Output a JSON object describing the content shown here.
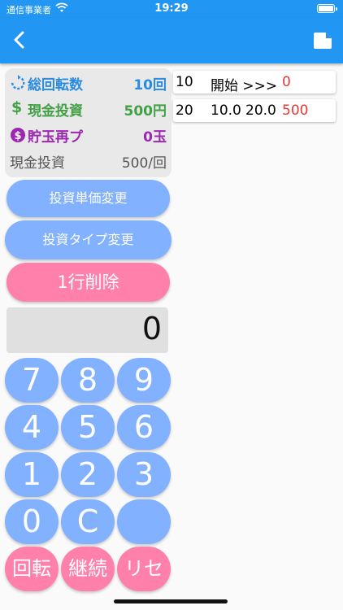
{
  "status_bar": {
    "carrier": "通信事業者",
    "time": "19:29"
  },
  "app_bar": {
    "back_icon": "back-arrow-icon",
    "action_icon": "document-icon"
  },
  "summary": {
    "rotations": {
      "label": "総回転数",
      "value": "10回",
      "icon": "rotate-icon"
    },
    "cash": {
      "label": "現金投資",
      "value": "500円",
      "icon": "dollar-icon"
    },
    "saved": {
      "label": "貯玉再プ",
      "value": "0玉",
      "icon": "coin-icon"
    },
    "unit": {
      "label": "現金投資",
      "value": "500/回"
    }
  },
  "buttons": {
    "change_unit": "投資単価変更",
    "change_type": "投資タイプ変更",
    "delete_row": "1行削除"
  },
  "display": {
    "value": "0"
  },
  "keypad": {
    "k7": "7",
    "k8": "8",
    "k9": "9",
    "k4": "4",
    "k5": "5",
    "k6": "6",
    "k1": "1",
    "k2": "2",
    "k3": "3",
    "k0": "0",
    "kc": "C",
    "kblank": "",
    "spin": "回転",
    "cont": "継続",
    "reset": "リセ"
  },
  "history": [
    {
      "count": "10",
      "a": "開始 >>>",
      "b": "",
      "amount": "0"
    },
    {
      "count": "20",
      "a": "10.0",
      "b": "20.0",
      "amount": "500"
    }
  ],
  "colors": {
    "primary": "#2196f3",
    "key_blue": "#82b1ff",
    "key_pink": "#ff80ab",
    "accent_red": "#e53935"
  }
}
